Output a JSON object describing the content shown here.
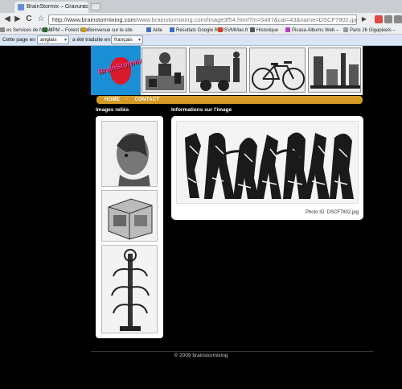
{
  "browser": {
    "tab_title": "BrainStormix – Gravures",
    "tab_close": "×",
    "url_main": "http://www.brainstormixing.com",
    "url_rest": "/www.brainstormixing.com/image3f54.html?m=5487&cat=43&name=DSCF7802.jpg",
    "nav": {
      "back": "◀",
      "forward": "▶",
      "reload": "C",
      "star": "☆",
      "go": "▶"
    },
    "bookmarks": [
      {
        "label": "es Services de NUMI",
        "color": "#888888"
      },
      {
        "label": "UPM – Forest Life",
        "color": "#2e6b2e"
      },
      {
        "label": "Bienvenue sur le site",
        "color": "#c79a2a"
      },
      {
        "label": "Aide",
        "color": "#3a6fc0"
      },
      {
        "label": "Résultats Google Recl",
        "color": "#3a6fc0"
      },
      {
        "label": "SVMMac.fr",
        "color": "#d04020"
      },
      {
        "label": "Historique",
        "color": "#555555"
      },
      {
        "label": "Picasa Albums Web –",
        "color": "#b040c0"
      },
      {
        "label": "Paris 26 Gigapixels –",
        "color": "#999999"
      }
    ],
    "translate": {
      "prefix": "Cette page en",
      "source_lang": "anglais",
      "middle": "a été traduite en",
      "target_lang": "français"
    }
  },
  "site": {
    "logo_text": "BrainStormix",
    "menu": [
      "HOME",
      "CONTACT"
    ],
    "related_title": "Images reliés",
    "info_title": "Informations sur l'image",
    "photo_id": "Photo ID: DSCF7802.jpg",
    "footer": "© 2009 brainstormixing"
  },
  "colors": {
    "menu_bar": "#d59b26",
    "page_bg": "#000000",
    "logo_bg": "#1a8fd6",
    "logo_text": "#ff3fb0"
  }
}
